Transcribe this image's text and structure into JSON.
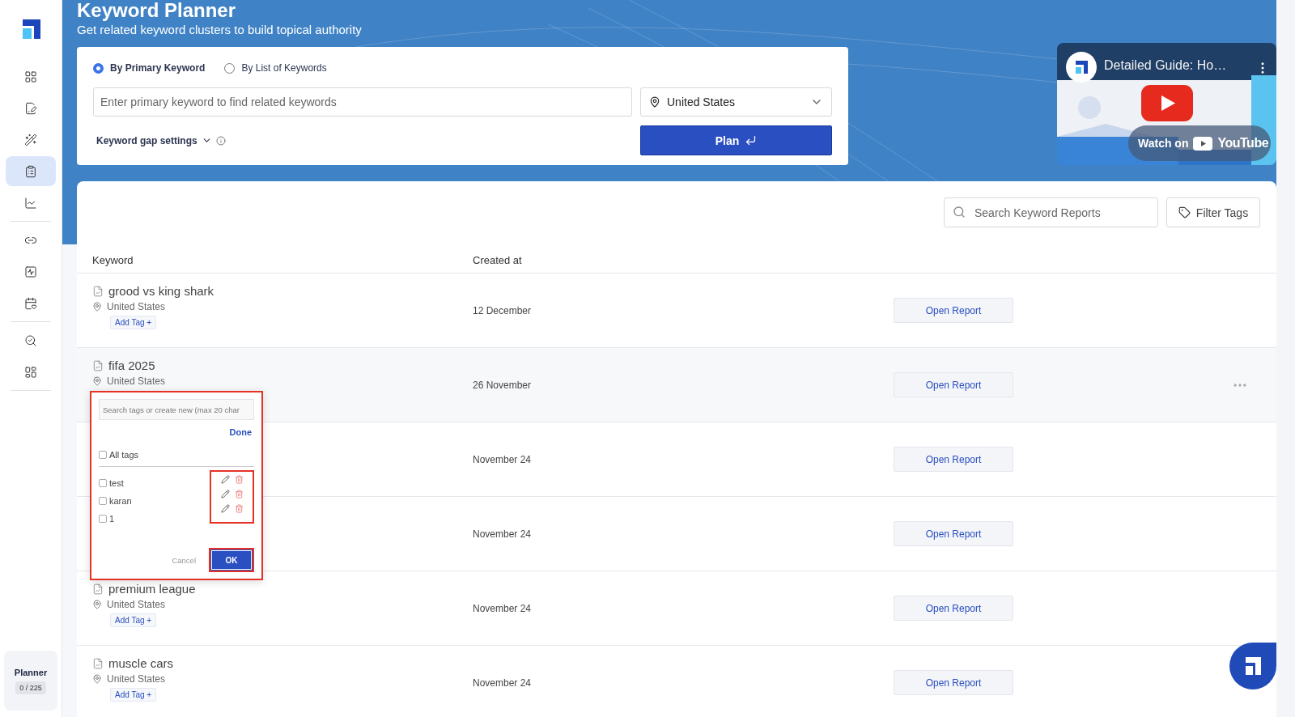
{
  "sidebar": {
    "groups": [
      {
        "items": [
          {
            "selected": false
          },
          {
            "selected": false
          },
          {
            "selected": false
          },
          {
            "selected": true
          },
          {
            "selected": false
          }
        ]
      },
      {
        "items": [
          {
            "selected": false
          },
          {
            "selected": false
          },
          {
            "selected": false
          }
        ]
      },
      {
        "items": [
          {
            "selected": false
          },
          {
            "selected": false
          }
        ]
      }
    ],
    "usage": {
      "label": "Planner",
      "count": "0 / 225"
    }
  },
  "header": {
    "title": "Keyword Planner",
    "subtitle": "Get related keyword clusters to build topical authority"
  },
  "search_card": {
    "modes": [
      {
        "label": "By Primary Keyword",
        "selected": true
      },
      {
        "label": "By List of Keywords",
        "selected": false
      }
    ],
    "keyword_input": {
      "placeholder": "Enter primary keyword to find related keywords"
    },
    "country": {
      "value": "United States"
    },
    "gap_settings": {
      "label": "Keyword gap settings"
    },
    "plan_button": {
      "label": "Plan"
    }
  },
  "video": {
    "title": "Detailed Guide: Ho…",
    "watch_label": "Watch on",
    "brand": "YouTube"
  },
  "reports": {
    "search": {
      "placeholder": "Search Keyword Reports"
    },
    "filter_button": "Filter Tags",
    "columns": [
      "Keyword",
      "Created at"
    ],
    "rows": [
      {
        "keyword": "grood vs king shark",
        "location": "United States",
        "tag_button": "Add Tag +",
        "created": "12 December",
        "action": "Open Report",
        "hovered": false
      },
      {
        "keyword": "fifa 2025",
        "location": "United States",
        "created": "26 November",
        "action": "Open Report",
        "hovered": true
      },
      {
        "created": "November 24",
        "action": "Open Report",
        "hovered": false
      },
      {
        "created": "November 24",
        "action": "Open Report",
        "hovered": false
      },
      {
        "keyword": "premium league",
        "location": "United States",
        "tag_button": "Add Tag +",
        "created": "November 24",
        "action": "Open Report",
        "hovered": false
      },
      {
        "keyword": "muscle cars",
        "location": "United States",
        "tag_button": "Add Tag +",
        "created": "November 24",
        "action": "Open Report",
        "hovered": false
      }
    ]
  },
  "tag_popup": {
    "search": {
      "placeholder": "Search tags or create new (max 20 char"
    },
    "done": "Done",
    "all_tags": {
      "label": "All tags",
      "checked": false
    },
    "tags": [
      {
        "label": "test",
        "checked": false
      },
      {
        "label": "karan",
        "checked": false
      },
      {
        "label": "1",
        "checked": false
      }
    ],
    "cancel": "Cancel",
    "ok": "OK"
  }
}
